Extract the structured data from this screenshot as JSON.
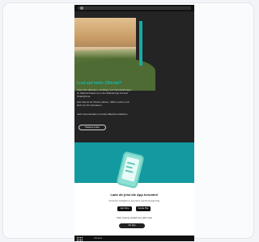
{
  "page": {
    "headline": "Lust auf mehr Zillertal?",
    "paragraphs": [
      "Tipps fürs Wandern, Ausflüge und Veranstaltungen im Zillertal findest du in der Zillertal App für dein Smartphone.",
      "Hier kannst du Touren planen, offline nutzen und dich vor Ort orientieren.",
      "Jetzt herunterladen und das Zillertal entdecken."
    ],
    "cta_label": "Weitere Infos",
    "app": {
      "title": "Lade dir jetzt die App herunter!",
      "subtitle": "Kostenlos verfügbar im App Store und bei Google Play",
      "store_apple": "App Store",
      "store_google": "Google Play",
      "note": "Oder scanne einfach den QR-Code",
      "button_label": "Zur App"
    },
    "footer_text": "zillertal.at"
  }
}
